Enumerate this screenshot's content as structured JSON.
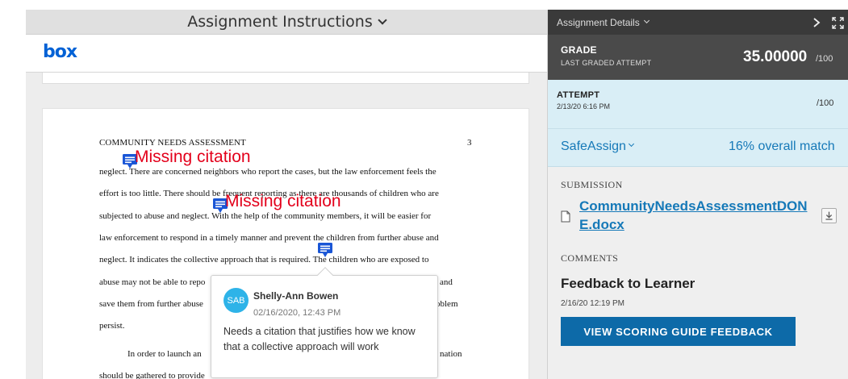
{
  "left_panel": {
    "header_title": "Assignment Instructions",
    "logo_text": "box"
  },
  "document": {
    "running_head": "COMMUNITY NEEDS ASSESSMENT",
    "page_number": "3",
    "lines": [
      "neglect. There are concerned neighbors who report the cases, but the law enforcement feels the",
      "effort is too little. There should be frequent reporting as there are thousands of children who are",
      "subjected to abuse and neglect. With the help of the community members, it will be easier for",
      "law enforcement to respond in a timely manner and prevent the children from further abuse and",
      "neglect. It indicates the collective approach that is required. The children who are exposed to",
      "abuse may not be able to repo",
      "save them from further abuse",
      "persist.",
      "In order to launch an",
      "should be gathered to provide"
    ],
    "line_tails": [
      "and",
      "oblem",
      "nation"
    ],
    "annotations": [
      {
        "label": "Missing citation"
      },
      {
        "label": "Missing citation"
      }
    ]
  },
  "comment": {
    "initials": "SAB",
    "author": "Shelly-Ann Bowen",
    "timestamp": "02/16/2020, 12:43 PM",
    "text": "Needs a citation that justifies how we know that a collective approach will work"
  },
  "right_panel": {
    "details_title": "Assignment Details",
    "grade": {
      "label": "GRADE",
      "sub": "LAST GRADED ATTEMPT",
      "value": "35.00000",
      "max": "/100"
    },
    "attempt": {
      "label": "ATTEMPT",
      "date": "2/13/20 6:16 PM",
      "max": "/100"
    },
    "safeassign": {
      "label": "SafeAssign",
      "match": "16% overall match"
    },
    "submission": {
      "label": "SUBMISSION",
      "file_name": "CommunityNeedsAssessmentDONE.docx"
    },
    "comments": {
      "label": "COMMENTS",
      "feedback_title": "Feedback to Learner",
      "feedback_date": "2/16/20 12:19 PM",
      "button_label": "VIEW SCORING GUIDE FEEDBACK"
    }
  },
  "colors": {
    "accent_blue": "#1679b8",
    "box_blue": "#0061d5",
    "annotation_red": "#e3001b",
    "annotation_icon": "#1a56d6",
    "attempt_bg": "#d9eef6",
    "grade_bg": "#4a4a4a"
  }
}
